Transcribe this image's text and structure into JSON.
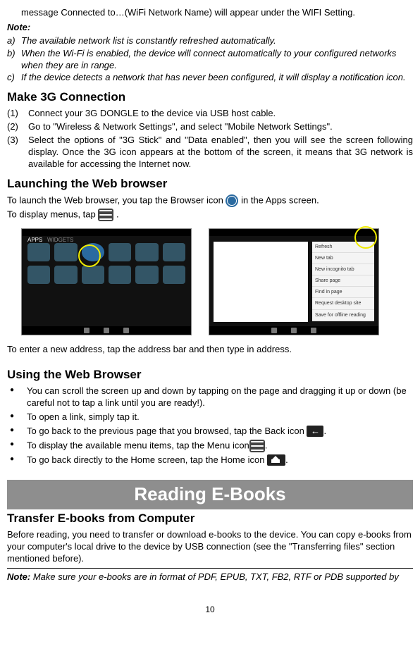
{
  "intro": "message Connected to…(WiFi Network Name) will appear under the WIFI Setting.",
  "note_label": "Note:",
  "notes": {
    "a": "The available network list is constantly refreshed automatically.",
    "b": "When the Wi-Fi is enabled, the device will connect automatically to your configured networks when they are in range.",
    "c": "If the device detects a network that has never been configured, it will display a notification icon."
  },
  "h_3g": "Make 3G Connection",
  "steps3g": {
    "1": "Connect your 3G DONGLE to the device via USB host cable.",
    "2": "Go to \"Wireless & Network Settings\", and select \"Mobile Network Settings\".",
    "3": "Select the options of \"3G Stick\" and \"Data enabled\", then you will see the screen following display. Once the 3G icon appears at the bottom of the screen, it means that 3G network is available for accessing the Internet now."
  },
  "h_launch": "Launching the Web browser",
  "launch1_pre": "To launch the Web browser, you tap the Browser icon ",
  "launch1_post": " in the Apps screen.",
  "launch2_pre": "To display menus, tap ",
  "launch2_post": " .",
  "addr_line": "To enter a new address, tap the address bar and then type in address.",
  "h_using": "Using the Web Browser",
  "using": {
    "1": "You can scroll the screen up and down by tapping on the page and dragging it up or down (be careful not to tap a link until you are ready!).",
    "2": "To open a link, simply tap it.",
    "3a": "To go back to the previous page that you browsed, tap the Back icon ",
    "3b": ".",
    "4a": "To display the available menu items, tap the Menu icon",
    "4b": ".",
    "5a": "To go back directly to the Home screen, tap the Home icon ",
    "5b": "."
  },
  "banner": "Reading E-Books",
  "h_transfer": "Transfer E-books from Computer",
  "transfer_body": "Before reading, you need to transfer or download e-books to the device. You can copy e-books from your computer's local drive to the device by USB connection (see the \"Transferring files\" section mentioned before).",
  "note2_pre": "Note:",
  "note2_body": " Make sure your e-books are in format of PDF, EPUB, TXT, FB2, RTF or PDB supported by",
  "pagenum": "10",
  "shot1_tab1": "APPS",
  "shot1_tab2": "WIDGETS",
  "menu_items": [
    "Refresh",
    "New tab",
    "New incognito tab",
    "Share page",
    "Find in page",
    "Request desktop site",
    "Save for offline reading"
  ]
}
